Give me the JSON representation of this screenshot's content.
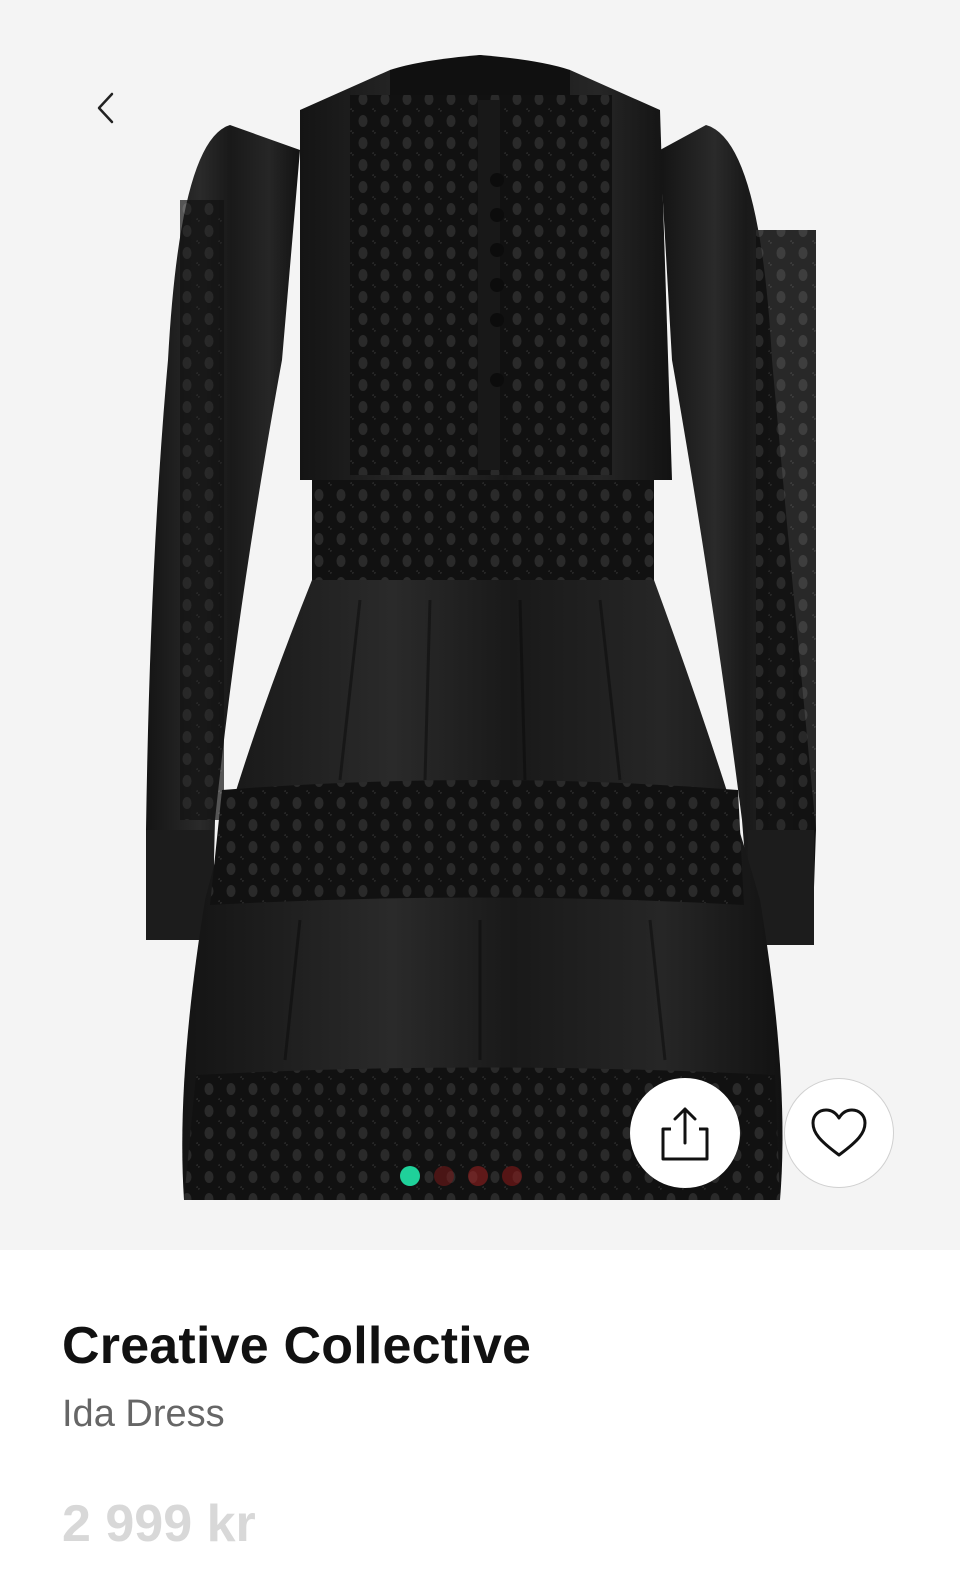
{
  "product": {
    "brand": "Creative Collective",
    "name": "Ida Dress",
    "price": "2 999 kr"
  },
  "gallery": {
    "image_alt": "Black satin mini dress with crochet lace panels",
    "dot_colors": [
      "#1fd19a",
      "#7a1a1a",
      "#a02020",
      "#8e1a1a"
    ],
    "active_index": 0
  },
  "icons": {
    "back": "chevron-left-icon",
    "share": "share-icon",
    "wishlist": "heart-icon"
  },
  "colors": {
    "background": "#f4f4f4",
    "dress": "#151515",
    "active_dot": "#1fd19a",
    "price": "#d8d8d8"
  }
}
